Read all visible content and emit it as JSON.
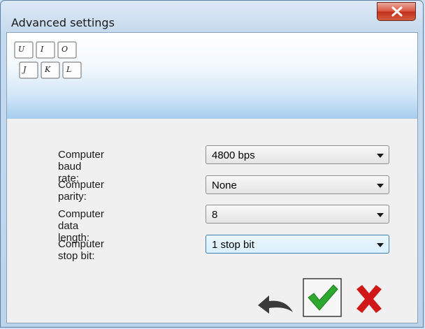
{
  "window": {
    "title": "Advanced settings"
  },
  "banner": {
    "keys_row1": [
      "U",
      "I",
      "O"
    ],
    "keys_row2": [
      "J",
      "K",
      "L"
    ]
  },
  "form": {
    "rows": [
      {
        "label": "Computer baud rate:",
        "value": "4800 bps"
      },
      {
        "label": "Computer parity:",
        "value": "None"
      },
      {
        "label": "Computer data length:",
        "value": "8"
      },
      {
        "label": "Computer stop bit:",
        "value": "1 stop bit"
      }
    ]
  },
  "actions": {
    "undo": "undo-icon",
    "ok": "checkmark-icon",
    "cancel": "cross-icon"
  },
  "colors": {
    "ok_green": "#2ea82e",
    "cancel_red": "#d01818",
    "close_red": "#c1301b"
  }
}
